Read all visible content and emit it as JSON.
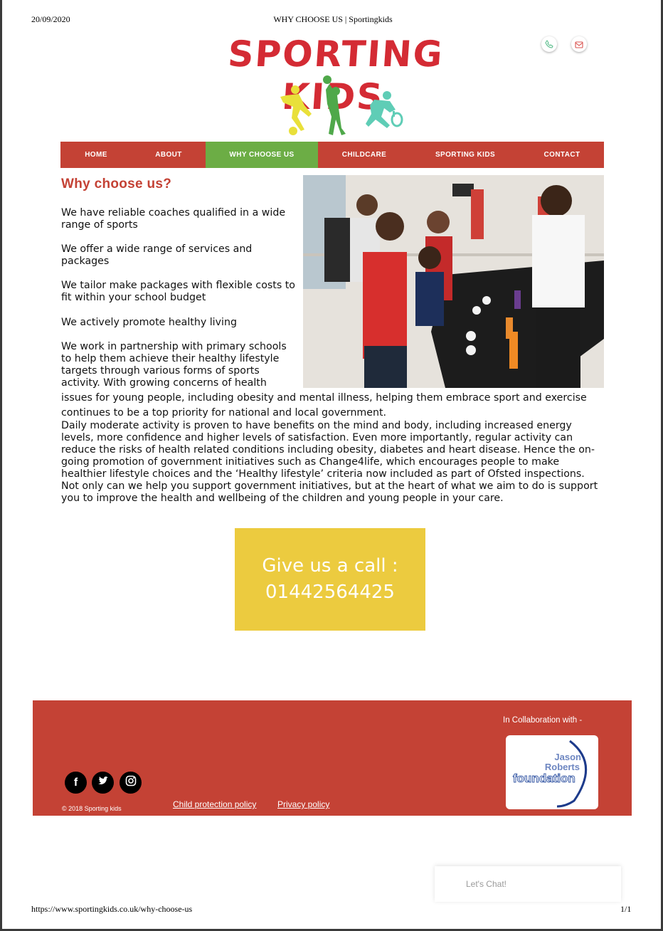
{
  "print_header": {
    "date": "20/09/2020",
    "title": "WHY CHOOSE US | Sportingkids"
  },
  "print_footer": {
    "url": "https://www.sportingkids.co.uk/why-choose-us",
    "page": "1/1"
  },
  "logo": {
    "text": "SPORTING KIDS",
    "colors": {
      "text": "#d42b34",
      "figure_yellow": "#e9e03a",
      "figure_green": "#4fa84a",
      "figure_teal": "#5fcdb6"
    }
  },
  "contact_icons": [
    "phone-icon",
    "mail-icon"
  ],
  "nav": {
    "items": [
      {
        "label": "HOME"
      },
      {
        "label": "ABOUT"
      },
      {
        "label": "WHY CHOOSE US",
        "active": true
      },
      {
        "label": "CHILDCARE"
      },
      {
        "label": "SPORTING KIDS"
      },
      {
        "label": "CONTACT"
      }
    ],
    "colors": {
      "bar": "#c44235",
      "active": "#6cad45",
      "text": "#ffffff"
    }
  },
  "content": {
    "heading": "Why choose us?",
    "paragraphs": [
      "We have reliable coaches qualified in a wide range of sports",
      "We offer a wide range of services and packages",
      "We tailor make packages with flexible costs to fit within your school budget",
      "We actively promote healthy living"
    ],
    "partnership_lines": [
      "We work in partnership with primary schools",
      "to help them achieve their healthy lifestyle",
      "targets through various forms of sports",
      "activity.  With growing concerns of health",
      "issues for young people, including obesity and mental illness, helping them embrace sport and exercise",
      "continues to be a top priority for national and local government."
    ],
    "daily_activity": "Daily moderate activity is proven to have benefits on the mind and body, including increased energy levels, more confidence and higher levels of satisfaction.  Even more importantly, regular activity can reduce the risks of health related conditions including obesity, diabetes and heart disease.  Hence the on-going promotion of government initiatives such as Change4life, which encourages people to make healthier lifestyle choices and the ‘Healthy lifestyle’ criteria now included as part of Ofsted inspections.  Not only can we help you support government initiatives, but at the heart of what we aim to do is support you to improve the health and wellbeing of the children and young people in your care."
  },
  "cta": {
    "line1": "Give us a call :",
    "line2": "01442564425",
    "color": "#eccb3f"
  },
  "footer": {
    "collaboration": "In Collaboration with -",
    "partner_logo_text": [
      "Jason",
      "Roberts",
      "foundation"
    ],
    "copyright": "© 2018 Sporting kids",
    "links": [
      "Child protection policy",
      "Privacy policy"
    ],
    "social": [
      "facebook-icon",
      "twitter-icon",
      "instagram-icon"
    ],
    "color": "#c44235"
  },
  "chat": {
    "label": "Let's Chat!"
  }
}
